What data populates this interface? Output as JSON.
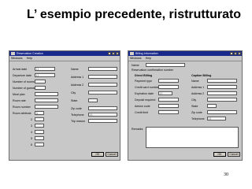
{
  "slide": {
    "title": "L’ esempio precedente, ristrutturato",
    "page_number": "30"
  },
  "reservation_window": {
    "title": "Reservation Creation",
    "controls": [
      "_",
      "□",
      "x"
    ],
    "menu": [
      "Windows",
      "Help"
    ],
    "left_fields": [
      {
        "label": "Arrival date",
        "value": "/  /"
      },
      {
        "label": "Departure date",
        "value": "/  /"
      },
      {
        "label": "Number of rooms",
        "value": ""
      },
      {
        "label": "Number of guests",
        "value": ""
      },
      {
        "label": "Meal plan",
        "value": ""
      },
      {
        "label": "Room rate",
        "value": ""
      },
      {
        "label": "Room number",
        "value": ""
      },
      {
        "label": "Room attribute",
        "value": "1"
      }
    ],
    "attribute_rows": [
      "2",
      "3",
      "4",
      "5",
      "6"
    ],
    "right_fields": [
      {
        "label": "Name",
        "value": ""
      },
      {
        "label": "Address 1",
        "value": ""
      },
      {
        "label": "Address 2",
        "value": ""
      },
      {
        "label": "City",
        "value": ""
      },
      {
        "label": "State",
        "value": ""
      },
      {
        "label": "Zip code",
        "value": ""
      },
      {
        "label": "Telephone",
        "value": "(  )"
      },
      {
        "label": "Trip reason",
        "value": ""
      }
    ]
  },
  "billing_window": {
    "title": "Billing Information",
    "controls": [
      "_",
      "□",
      "x"
    ],
    "menu": [
      "Windows",
      "Help"
    ],
    "top_fields": [
      {
        "label": "Name",
        "value": ""
      },
      {
        "label": "Reservation confirmation number",
        "value": ""
      }
    ],
    "direct_billing": {
      "heading": "Direct Billing",
      "fields": [
        {
          "label": "Payment type",
          "value": ""
        },
        {
          "label": "Credit card number",
          "value": ""
        },
        {
          "label": "Expiration date",
          "value": "/  /"
        },
        {
          "label": "Deposit required",
          "value": ""
        },
        {
          "label": "Advice code",
          "value": ""
        },
        {
          "label": "Credit limit",
          "value": ""
        }
      ]
    },
    "caption_billing": {
      "heading": "Caption Billing",
      "fields": [
        {
          "label": "Name",
          "value": ""
        },
        {
          "label": "Address 1",
          "value": ""
        },
        {
          "label": "Address 2",
          "value": ""
        },
        {
          "label": "City",
          "value": ""
        },
        {
          "label": "State",
          "value": ""
        },
        {
          "label": "Zip code",
          "value": ""
        },
        {
          "label": "Telephone",
          "value": "(  )"
        }
      ]
    },
    "remarks_label": "Remarks"
  },
  "buttons": {
    "ok": "OK",
    "cancel": "Cancel"
  },
  "colors": {
    "titlebar": "#1a2a8c",
    "window": "#c8c8c8",
    "field": "#ffffff"
  }
}
